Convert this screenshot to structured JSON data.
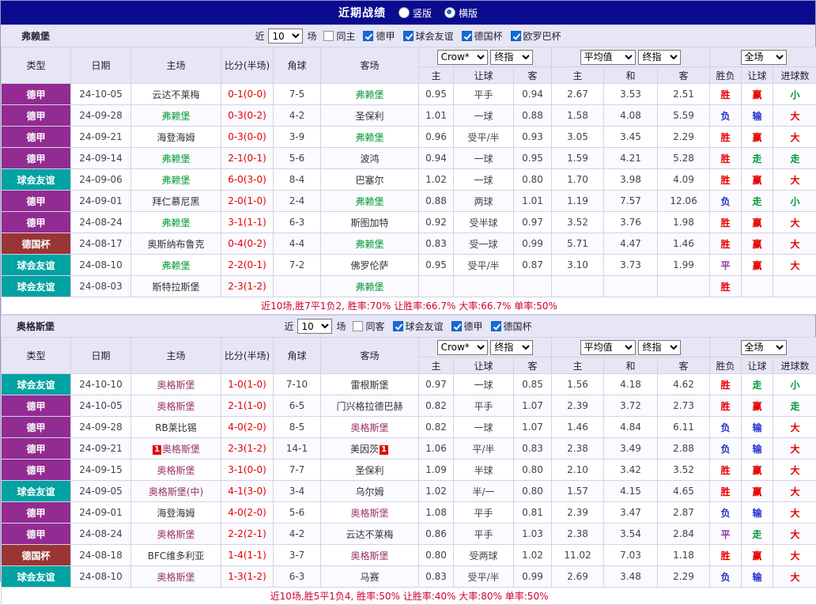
{
  "topbar": {
    "title": "近期战绩",
    "radios": [
      {
        "label": "竖版",
        "selected": false
      },
      {
        "label": "横版",
        "selected": true
      }
    ]
  },
  "table_headers": {
    "type": "类型",
    "date": "日期",
    "home": "主场",
    "score": "比分(半场)",
    "corner": "角球",
    "away": "客场",
    "sub": [
      "主",
      "让球",
      "客",
      "主",
      "和",
      "客",
      "胜负",
      "让球",
      "进球数"
    ]
  },
  "palette": {
    "league": {
      "德甲": "#922b92",
      "球会友谊": "#00a2a2",
      "德国杯": "#9a3535"
    },
    "text": {
      "red": "#e60000",
      "blue": "#2233cc",
      "green": "#009933",
      "purple": "#8833aa",
      "maroon": "#993366",
      "black": "#333333"
    }
  },
  "sections": [
    {
      "team": "弗赖堡",
      "near_label": "近",
      "count": "10",
      "games_label": "场",
      "filters": [
        {
          "label": "同主",
          "checked": false
        },
        {
          "label": "德甲",
          "checked": true
        },
        {
          "label": "球会友谊",
          "checked": true
        },
        {
          "label": "德国杯",
          "checked": true
        },
        {
          "label": "欧罗巴杯",
          "checked": true
        }
      ],
      "selects": {
        "odds_src": "Crow*",
        "odds_idx": "终指",
        "avg_src": "平均值",
        "avg_idx": "终指",
        "scope": "全场"
      },
      "rows": [
        {
          "league": "德甲",
          "date": "24-10-05",
          "home": {
            "name": "云达不莱梅",
            "color": "black"
          },
          "score": "0-1(0-0)",
          "corner": "7-5",
          "away": {
            "name": "弗赖堡",
            "color": "green"
          },
          "odds": [
            "0.95",
            "平手",
            "0.94"
          ],
          "avg": [
            "2.67",
            "3.53",
            "2.51"
          ],
          "outcome": [
            [
              "胜",
              "red"
            ],
            [
              "赢",
              "red"
            ],
            [
              "小",
              "green"
            ]
          ]
        },
        {
          "league": "德甲",
          "date": "24-09-28",
          "home": {
            "name": "弗赖堡",
            "color": "green"
          },
          "score": "0-3(0-2)",
          "corner": "4-2",
          "away": {
            "name": "圣保利",
            "color": "black"
          },
          "odds": [
            "1.01",
            "一球",
            "0.88"
          ],
          "avg": [
            "1.58",
            "4.08",
            "5.59"
          ],
          "outcome": [
            [
              "负",
              "blue"
            ],
            [
              "输",
              "blue"
            ],
            [
              "大",
              "red"
            ]
          ]
        },
        {
          "league": "德甲",
          "date": "24-09-21",
          "home": {
            "name": "海登海姆",
            "color": "black"
          },
          "score": "0-3(0-0)",
          "corner": "3-9",
          "away": {
            "name": "弗赖堡",
            "color": "green"
          },
          "odds": [
            "0.96",
            "受平/半",
            "0.93"
          ],
          "avg": [
            "3.05",
            "3.45",
            "2.29"
          ],
          "outcome": [
            [
              "胜",
              "red"
            ],
            [
              "赢",
              "red"
            ],
            [
              "大",
              "red"
            ]
          ]
        },
        {
          "league": "德甲",
          "date": "24-09-14",
          "home": {
            "name": "弗赖堡",
            "color": "green"
          },
          "score": "2-1(0-1)",
          "corner": "5-6",
          "away": {
            "name": "波鸿",
            "color": "black"
          },
          "odds": [
            "0.94",
            "一球",
            "0.95"
          ],
          "avg": [
            "1.59",
            "4.21",
            "5.28"
          ],
          "outcome": [
            [
              "胜",
              "red"
            ],
            [
              "走",
              "green"
            ],
            [
              "走",
              "green"
            ]
          ]
        },
        {
          "league": "球会友谊",
          "date": "24-09-06",
          "home": {
            "name": "弗赖堡",
            "color": "green"
          },
          "score": "6-0(3-0)",
          "corner": "8-4",
          "away": {
            "name": "巴塞尔",
            "color": "black"
          },
          "odds": [
            "1.02",
            "一球",
            "0.80"
          ],
          "avg": [
            "1.70",
            "3.98",
            "4.09"
          ],
          "outcome": [
            [
              "胜",
              "red"
            ],
            [
              "赢",
              "red"
            ],
            [
              "大",
              "red"
            ]
          ]
        },
        {
          "league": "德甲",
          "date": "24-09-01",
          "home": {
            "name": "拜仁慕尼黑",
            "color": "black"
          },
          "score": "2-0(1-0)",
          "corner": "2-4",
          "away": {
            "name": "弗赖堡",
            "color": "green"
          },
          "odds": [
            "0.88",
            "两球",
            "1.01"
          ],
          "avg": [
            "1.19",
            "7.57",
            "12.06"
          ],
          "outcome": [
            [
              "负",
              "blue"
            ],
            [
              "走",
              "green"
            ],
            [
              "小",
              "green"
            ]
          ]
        },
        {
          "league": "德甲",
          "date": "24-08-24",
          "home": {
            "name": "弗赖堡",
            "color": "green"
          },
          "score": "3-1(1-1)",
          "corner": "6-3",
          "away": {
            "name": "斯图加特",
            "color": "black"
          },
          "odds": [
            "0.92",
            "受半球",
            "0.97"
          ],
          "avg": [
            "3.52",
            "3.76",
            "1.98"
          ],
          "outcome": [
            [
              "胜",
              "red"
            ],
            [
              "赢",
              "red"
            ],
            [
              "大",
              "red"
            ]
          ]
        },
        {
          "league": "德国杯",
          "date": "24-08-17",
          "home": {
            "name": "奥斯纳布鲁克",
            "color": "black"
          },
          "score": "0-4(0-2)",
          "corner": "4-4",
          "away": {
            "name": "弗赖堡",
            "color": "green"
          },
          "odds": [
            "0.83",
            "受一球",
            "0.99"
          ],
          "avg": [
            "5.71",
            "4.47",
            "1.46"
          ],
          "outcome": [
            [
              "胜",
              "red"
            ],
            [
              "赢",
              "red"
            ],
            [
              "大",
              "red"
            ]
          ]
        },
        {
          "league": "球会友谊",
          "date": "24-08-10",
          "home": {
            "name": "弗赖堡",
            "color": "green"
          },
          "score": "2-2(0-1)",
          "corner": "7-2",
          "away": {
            "name": "佛罗伦萨",
            "color": "black"
          },
          "odds": [
            "0.95",
            "受平/半",
            "0.87"
          ],
          "avg": [
            "3.10",
            "3.73",
            "1.99"
          ],
          "outcome": [
            [
              "平",
              "purple"
            ],
            [
              "赢",
              "red"
            ],
            [
              "大",
              "red"
            ]
          ]
        },
        {
          "league": "球会友谊",
          "date": "24-08-03",
          "home": {
            "name": "斯特拉斯堡",
            "color": "black"
          },
          "score": "2-3(1-2)",
          "corner": "",
          "away": {
            "name": "弗赖堡",
            "color": "green"
          },
          "odds": [
            "",
            "",
            ""
          ],
          "avg": [
            "",
            "",
            ""
          ],
          "outcome": [
            [
              "胜",
              "red"
            ],
            [
              "",
              ""
            ],
            [
              "",
              ""
            ]
          ]
        }
      ],
      "summary": "近10场,胜7平1负2, 胜率:70% 让胜率:66.7% 大率:66.7% 单率:50%"
    },
    {
      "team": "奥格斯堡",
      "near_label": "近",
      "count": "10",
      "games_label": "场",
      "filters": [
        {
          "label": "同客",
          "checked": false
        },
        {
          "label": "球会友谊",
          "checked": true
        },
        {
          "label": "德甲",
          "checked": true
        },
        {
          "label": "德国杯",
          "checked": true
        }
      ],
      "selects": {
        "odds_src": "Crow*",
        "odds_idx": "终指",
        "avg_src": "平均值",
        "avg_idx": "终指",
        "scope": "全场"
      },
      "rows": [
        {
          "league": "球会友谊",
          "date": "24-10-10",
          "home": {
            "name": "奥格斯堡",
            "color": "maroon"
          },
          "score": "1-0(1-0)",
          "corner": "7-10",
          "away": {
            "name": "雷根斯堡",
            "color": "black"
          },
          "odds": [
            "0.97",
            "一球",
            "0.85"
          ],
          "avg": [
            "1.56",
            "4.18",
            "4.62"
          ],
          "outcome": [
            [
              "胜",
              "red"
            ],
            [
              "走",
              "green"
            ],
            [
              "小",
              "green"
            ]
          ]
        },
        {
          "league": "德甲",
          "date": "24-10-05",
          "home": {
            "name": "奥格斯堡",
            "color": "maroon"
          },
          "score": "2-1(1-0)",
          "corner": "6-5",
          "away": {
            "name": "门兴格拉德巴赫",
            "color": "black"
          },
          "odds": [
            "0.82",
            "平手",
            "1.07"
          ],
          "avg": [
            "2.39",
            "3.72",
            "2.73"
          ],
          "outcome": [
            [
              "胜",
              "red"
            ],
            [
              "赢",
              "red"
            ],
            [
              "走",
              "green"
            ]
          ]
        },
        {
          "league": "德甲",
          "date": "24-09-28",
          "home": {
            "name": "RB莱比锡",
            "color": "black"
          },
          "score": "4-0(2-0)",
          "corner": "8-5",
          "away": {
            "name": "奥格斯堡",
            "color": "maroon"
          },
          "odds": [
            "0.82",
            "一球",
            "1.07"
          ],
          "avg": [
            "1.46",
            "4.84",
            "6.11"
          ],
          "outcome": [
            [
              "负",
              "blue"
            ],
            [
              "输",
              "blue"
            ],
            [
              "大",
              "red"
            ]
          ]
        },
        {
          "league": "德甲",
          "date": "24-09-21",
          "home": {
            "name": "奥格斯堡",
            "color": "maroon",
            "card": "1"
          },
          "score": "2-3(1-2)",
          "corner": "14-1",
          "away": {
            "name": "美因茨",
            "color": "black",
            "card": "1"
          },
          "odds": [
            "1.06",
            "平/半",
            "0.83"
          ],
          "avg": [
            "2.38",
            "3.49",
            "2.88"
          ],
          "outcome": [
            [
              "负",
              "blue"
            ],
            [
              "输",
              "blue"
            ],
            [
              "大",
              "red"
            ]
          ]
        },
        {
          "league": "德甲",
          "date": "24-09-15",
          "home": {
            "name": "奥格斯堡",
            "color": "maroon"
          },
          "score": "3-1(0-0)",
          "corner": "7-7",
          "away": {
            "name": "圣保利",
            "color": "black"
          },
          "odds": [
            "1.09",
            "半球",
            "0.80"
          ],
          "avg": [
            "2.10",
            "3.42",
            "3.52"
          ],
          "outcome": [
            [
              "胜",
              "red"
            ],
            [
              "赢",
              "red"
            ],
            [
              "大",
              "red"
            ]
          ]
        },
        {
          "league": "球会友谊",
          "date": "24-09-05",
          "home": {
            "name": "奥格斯堡(中)",
            "color": "maroon"
          },
          "score": "4-1(3-0)",
          "corner": "3-4",
          "away": {
            "name": "乌尔姆",
            "color": "black"
          },
          "odds": [
            "1.02",
            "半/一",
            "0.80"
          ],
          "avg": [
            "1.57",
            "4.15",
            "4.65"
          ],
          "outcome": [
            [
              "胜",
              "red"
            ],
            [
              "赢",
              "red"
            ],
            [
              "大",
              "red"
            ]
          ]
        },
        {
          "league": "德甲",
          "date": "24-09-01",
          "home": {
            "name": "海登海姆",
            "color": "black"
          },
          "score": "4-0(2-0)",
          "corner": "5-6",
          "away": {
            "name": "奥格斯堡",
            "color": "maroon"
          },
          "odds": [
            "1.08",
            "平手",
            "0.81"
          ],
          "avg": [
            "2.39",
            "3.47",
            "2.87"
          ],
          "outcome": [
            [
              "负",
              "blue"
            ],
            [
              "输",
              "blue"
            ],
            [
              "大",
              "red"
            ]
          ]
        },
        {
          "league": "德甲",
          "date": "24-08-24",
          "home": {
            "name": "奥格斯堡",
            "color": "maroon"
          },
          "score": "2-2(2-1)",
          "corner": "4-2",
          "away": {
            "name": "云达不莱梅",
            "color": "black"
          },
          "odds": [
            "0.86",
            "平手",
            "1.03"
          ],
          "avg": [
            "2.38",
            "3.54",
            "2.84"
          ],
          "outcome": [
            [
              "平",
              "purple"
            ],
            [
              "走",
              "green"
            ],
            [
              "大",
              "red"
            ]
          ]
        },
        {
          "league": "德国杯",
          "date": "24-08-18",
          "home": {
            "name": "BFC维多利亚",
            "color": "black"
          },
          "score": "1-4(1-1)",
          "corner": "3-7",
          "away": {
            "name": "奥格斯堡",
            "color": "maroon"
          },
          "odds": [
            "0.80",
            "受两球",
            "1.02"
          ],
          "avg": [
            "11.02",
            "7.03",
            "1.18"
          ],
          "outcome": [
            [
              "胜",
              "red"
            ],
            [
              "赢",
              "red"
            ],
            [
              "大",
              "red"
            ]
          ]
        },
        {
          "league": "球会友谊",
          "date": "24-08-10",
          "home": {
            "name": "奥格斯堡",
            "color": "maroon"
          },
          "score": "1-3(1-2)",
          "corner": "6-3",
          "away": {
            "name": "马赛",
            "color": "black"
          },
          "odds": [
            "0.83",
            "受平/半",
            "0.99"
          ],
          "avg": [
            "2.69",
            "3.48",
            "2.29"
          ],
          "outcome": [
            [
              "负",
              "blue"
            ],
            [
              "输",
              "blue"
            ],
            [
              "大",
              "red"
            ]
          ]
        }
      ],
      "summary": "近10场,胜5平1负4, 胜率:50% 让胜率:40% 大率:80% 单率:50%"
    }
  ]
}
